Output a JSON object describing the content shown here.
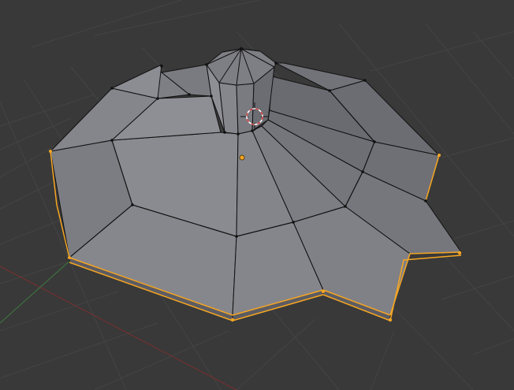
{
  "viewport": {
    "background_color": "#393939",
    "grid_color": "#444444",
    "x_axis_color": "#7a2f2f",
    "y_axis_color": "#3f7a3f",
    "mesh_face_color": "#828289",
    "mesh_face_light_color": "#8c8c93",
    "mesh_face_dark_color": "#6e6e75",
    "mesh_edge_color": "#111111",
    "selected_edge_color": "#f5a623",
    "vertex_color": "#111111",
    "selected_vertex_color": "#f5a623",
    "origin_color": "#f5a623",
    "cursor_ring_primary": "#d94040",
    "cursor_ring_secondary": "#ffffff",
    "view_mode": "edit-mode",
    "mesh_object": "octagonal-umbrella-mesh",
    "icons": [
      "3d-cursor-icon",
      "object-origin-icon"
    ]
  }
}
